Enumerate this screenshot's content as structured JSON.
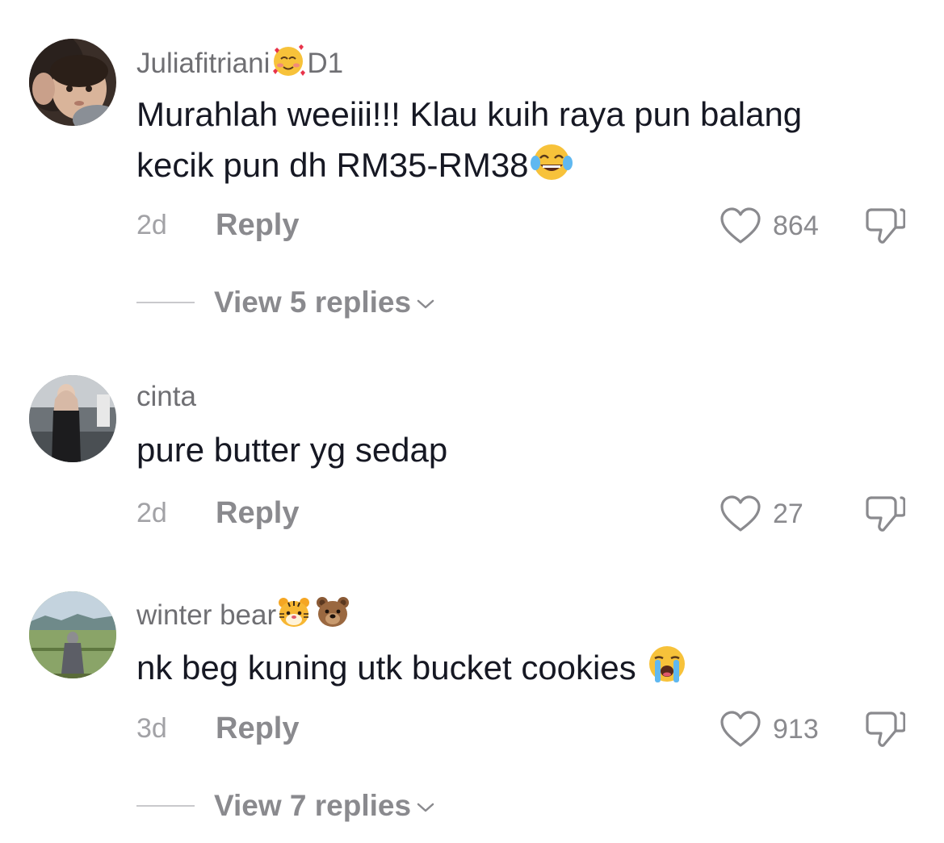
{
  "comments": [
    {
      "username": "Juliafitriani",
      "username_suffix": "D1",
      "username_emoji": "smiling-face-with-hearts",
      "text_line1": "Murahlah weeiii!!! Klau kuih raya pun balang",
      "text_line2": "kecik pun dh RM35-RM38",
      "text_emoji": "face-with-tears-of-joy",
      "time": "2d",
      "reply_label": "Reply",
      "likes": "864",
      "view_replies": "View 5 replies"
    },
    {
      "username": "cinta",
      "text_line1": "pure butter yg sedap",
      "time": "2d",
      "reply_label": "Reply",
      "likes": "27"
    },
    {
      "username": "winter bear",
      "username_emojis": [
        "tiger-face",
        "bear-face"
      ],
      "text_line1": "nk beg kuning utk bucket cookies",
      "text_emoji": "loudly-crying-face",
      "time": "3d",
      "reply_label": "Reply",
      "likes": "913",
      "view_replies": "View 7 replies"
    }
  ],
  "colors": {
    "text": "#161823",
    "muted": "#8a8a8e",
    "username": "#6f6f73",
    "time": "#a2a2a6"
  }
}
